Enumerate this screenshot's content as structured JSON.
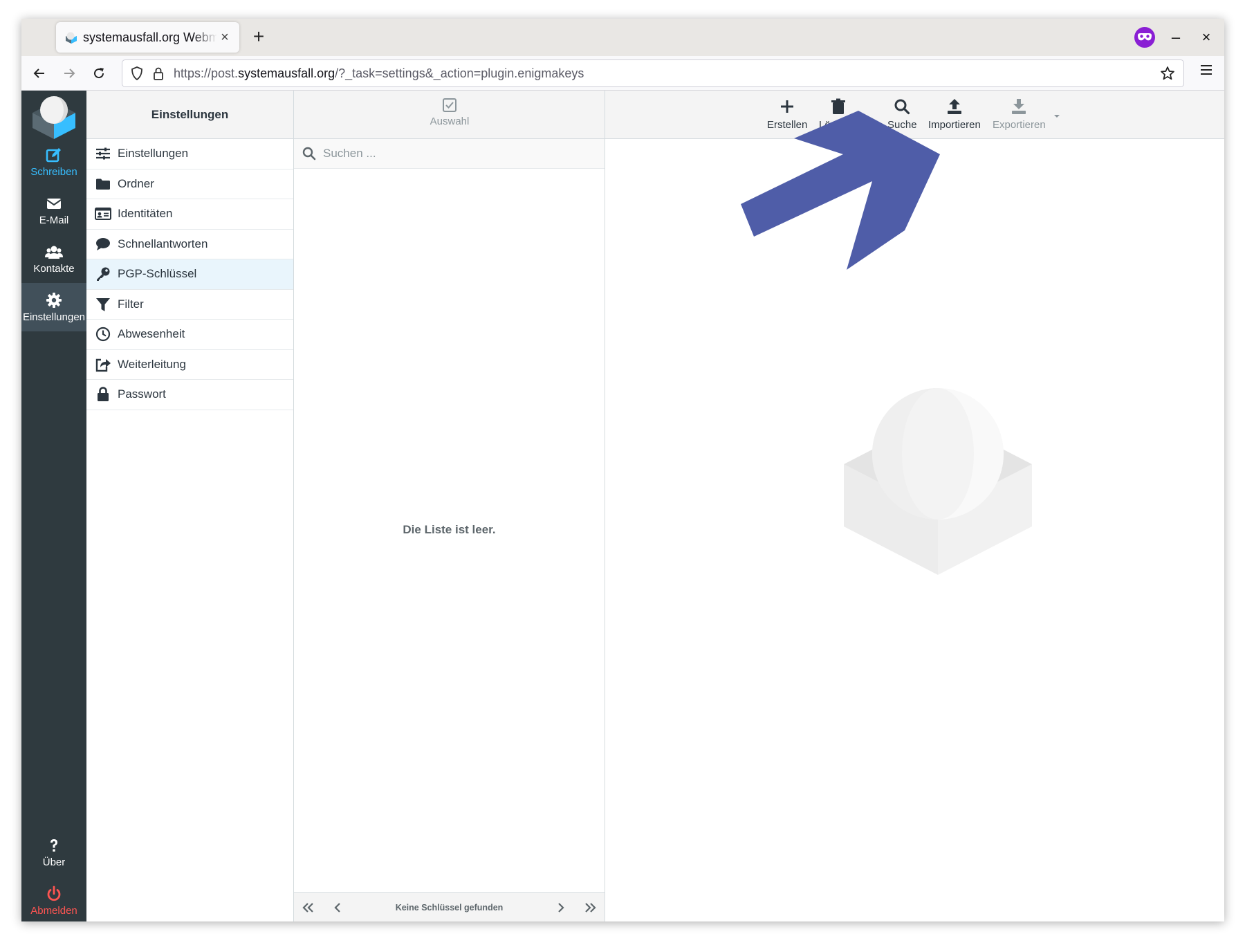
{
  "browser": {
    "tab_title": "systemausfall.org Webmail",
    "new_tab": "+",
    "close_tab": "×",
    "window_minimize": "–",
    "window_close": "×",
    "url_scheme_sub": "https://post.",
    "url_domain": "systemausfall.org",
    "url_path": "/?_task=settings&_action=plugin.enigmakeys"
  },
  "taskmenu": {
    "compose": "Schreiben",
    "mail": "E-Mail",
    "contacts": "Kontakte",
    "settings": "Einstellungen",
    "about": "Über",
    "logout": "Abmelden"
  },
  "settings": {
    "header": "Einstellungen",
    "items": [
      {
        "label": "Einstellungen",
        "icon": "sliders-icon"
      },
      {
        "label": "Ordner",
        "icon": "folder-icon"
      },
      {
        "label": "Identitäten",
        "icon": "id-card-icon"
      },
      {
        "label": "Schnellantworten",
        "icon": "comment-icon"
      },
      {
        "label": "PGP-Schlüssel",
        "icon": "key-icon"
      },
      {
        "label": "Filter",
        "icon": "filter-icon"
      },
      {
        "label": "Abwesenheit",
        "icon": "clock-icon"
      },
      {
        "label": "Weiterleitung",
        "icon": "share-icon"
      },
      {
        "label": "Passwort",
        "icon": "lock-icon"
      }
    ],
    "active_index": 4
  },
  "keys": {
    "select_label": "Auswahl",
    "search_placeholder": "Suchen ...",
    "empty_message": "Die Liste ist leer.",
    "count_label": "Keine Schlüssel gefunden"
  },
  "toolbar": {
    "create": "Erstellen",
    "delete": "Löschen",
    "search": "Suche",
    "import": "Importieren",
    "export": "Exportieren"
  },
  "colors": {
    "taskmenu_bg": "#2f3a3f",
    "accent": "#37beff",
    "logout": "#ff5552",
    "annotation_arrow": "#4f5da8"
  }
}
